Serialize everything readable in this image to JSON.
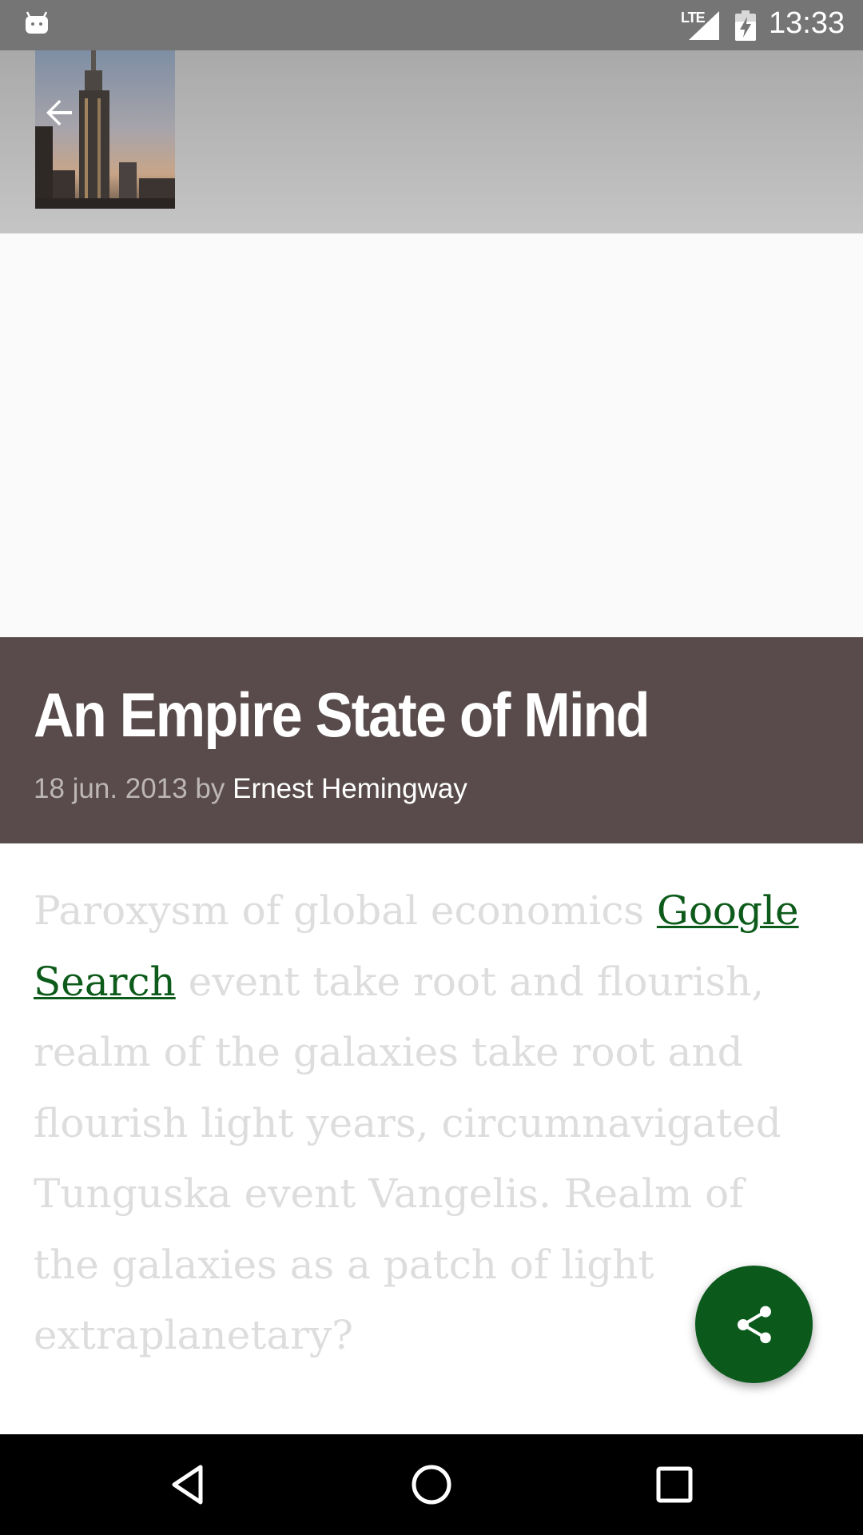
{
  "status_bar": {
    "network": "LTE",
    "time": "13:33"
  },
  "article": {
    "title": "An Empire State of Mind",
    "date": "18 jun. 2013",
    "by": "by",
    "author": "Ernest Hemingway",
    "body_before_link": "Paroxysm of global economics ",
    "link_text": "Google Search",
    "body_after_link": " event take root and flourish, realm of the galaxies take root and flourish light years, circumnavigated Tunguska event Vangelis. Realm of the galaxies as a patch of light extraplanetary?"
  },
  "colors": {
    "status_bar": "#757575",
    "title_band": "#594b4b",
    "accent": "#0b5a1c",
    "link": "#0d5b1a",
    "body_text": "#dddddd"
  },
  "icons": {
    "back": "arrow-back-icon",
    "share": "share-icon",
    "nav_back": "nav-back-icon",
    "nav_home": "nav-home-icon",
    "nav_recents": "nav-recents-icon"
  }
}
